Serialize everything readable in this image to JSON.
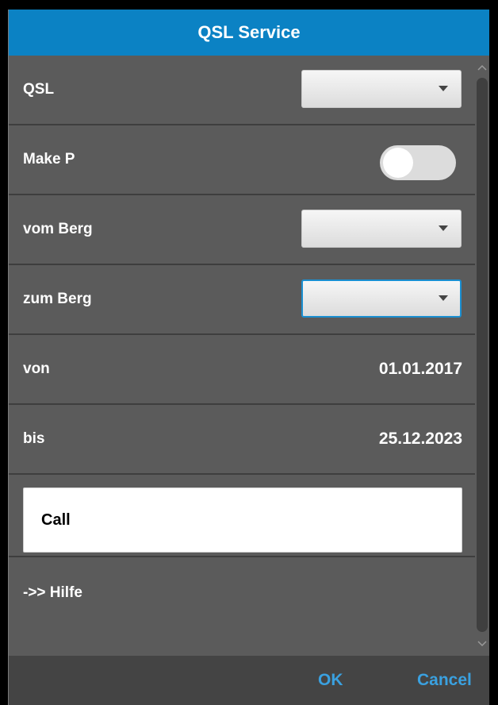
{
  "title": "QSL Service",
  "fields": {
    "qsl": {
      "label": "QSL",
      "selected": ""
    },
    "make_p": {
      "label": "Make P",
      "on": false
    },
    "vom_berg": {
      "label": "vom Berg",
      "selected": ""
    },
    "zum_berg": {
      "label": "zum Berg",
      "selected": ""
    },
    "von": {
      "label": "von",
      "value": "01.01.2017"
    },
    "bis": {
      "label": "bis",
      "value": "25.12.2023"
    },
    "call": {
      "placeholder": "Call",
      "value": ""
    }
  },
  "help_link": "->> Hilfe",
  "buttons": {
    "ok": "OK",
    "cancel": "Cancel"
  },
  "colors": {
    "titlebar": "#0b82c4",
    "background": "#5b5b5b",
    "footer": "#444444",
    "accent": "#3aa1e0"
  },
  "icons": {
    "dropdown": "chevron-down-icon",
    "scroll_up": "chevron-up-icon",
    "scroll_down": "chevron-down-icon"
  }
}
